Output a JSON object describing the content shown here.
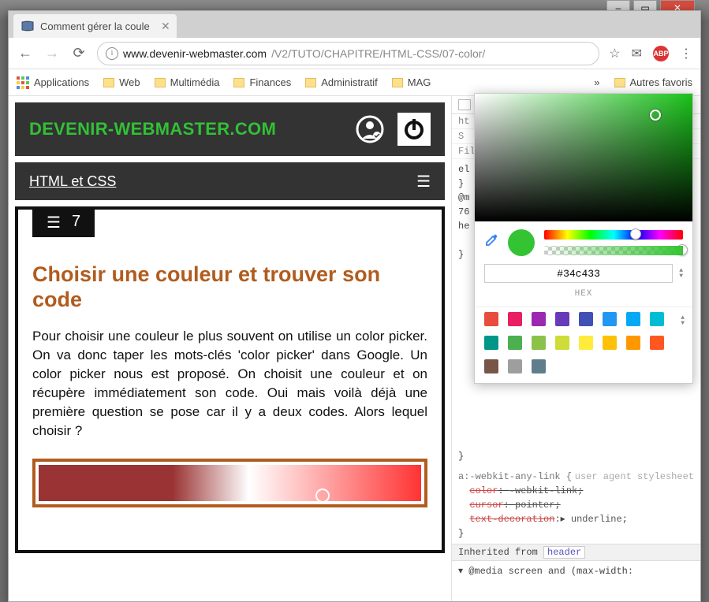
{
  "window": {
    "min": "–",
    "max": "▭",
    "close": "✕"
  },
  "browser": {
    "tab_title": "Comment gérer la coule",
    "url_host": "www.devenir-webmaster.com",
    "url_path": "/V2/TUTO/CHAPITRE/HTML-CSS/07-color/",
    "star": "☆",
    "gmail": "✉",
    "abp": "ABP",
    "menu": "⋮"
  },
  "nav": {
    "back": "←",
    "forward": "→",
    "reload": "⟳"
  },
  "bookmarks": {
    "apps": "Applications",
    "items": [
      "Web",
      "Multimédia",
      "Finances",
      "Administratif",
      "MAG"
    ],
    "overflow": "»",
    "other": "Autres favoris"
  },
  "site": {
    "brand": "DEVENIR-WEBMASTER.COM",
    "section_link": "HTML et CSS",
    "hamburger": "☰",
    "toc_icon": "☰",
    "toc_num": "7",
    "h1": "Choisir une couleur et trouver son code",
    "paragraph": "Pour choisir une couleur le plus souvent on utilise un color picker. On va donc taper les mots-clés 'color picker' dans Google. Un color picker nous est proposé. On choisit une couleur et on récupère immédiatement son code. Oui mais voilà déjà une première question se pose car il y a deux codes. Alors lequel choisir ?"
  },
  "devtools": {
    "partial1": "ht",
    "partial2": "S",
    "filter": "Filt",
    "el_open": "el",
    "brace": "}",
    "media_partial1": "@m",
    "media_partial2": "76",
    "media_partial3": "he",
    "selector1": "a:-webkit-any-link {",
    "ua_label": "user agent stylesheet",
    "props": [
      {
        "name": "color",
        "val": "-webkit-link",
        "strike": true
      },
      {
        "name": "cursor",
        "val": "pointer",
        "strike": true
      },
      {
        "name": "text-decoration",
        "val": "underline",
        "strike_name": true,
        "arrow": "▸"
      }
    ],
    "inherit_label": "Inherited from",
    "inherit_tag": "header",
    "media_rule": "@media screen and (max-width:"
  },
  "picker": {
    "hex_value": "#34c433",
    "hex_label": "HEX",
    "swatches": [
      "#e74c3c",
      "#e91e63",
      "#9c27b0",
      "#673ab7",
      "#3f51b5",
      "#2196f3",
      "#03a9f4",
      "#00bcd4",
      "#009688",
      "#4caf50",
      "#8bc34a",
      "#cddc39",
      "#ffeb3b",
      "#ffc107",
      "#ff9800",
      "#ff5722",
      "#795548",
      "#9e9e9e",
      "#607d8b"
    ]
  }
}
